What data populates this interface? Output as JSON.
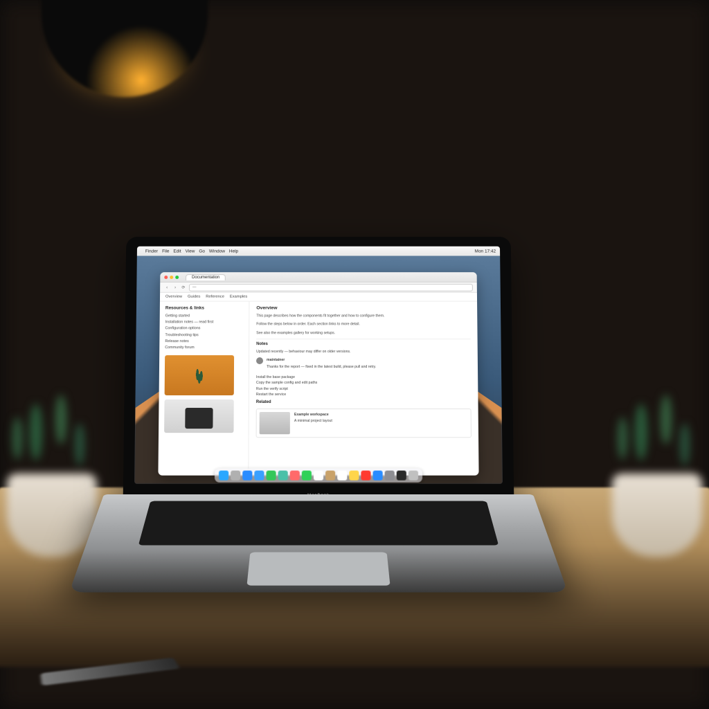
{
  "menubar": {
    "apple": "",
    "items": [
      "Finder",
      "File",
      "Edit",
      "View",
      "Go",
      "Window",
      "Help"
    ],
    "right": [
      "Mon 17:42"
    ]
  },
  "browser": {
    "tab_title": "Documentation",
    "url": "—",
    "nav": {
      "back": "‹",
      "forward": "›",
      "reload": "⟳"
    },
    "toolbar": [
      "Overview",
      "Guides",
      "Reference",
      "Examples"
    ]
  },
  "sidebar": {
    "heading": "Resources & links",
    "items": [
      "Getting started",
      "Installation notes — read first",
      "Configuration options",
      "Troubleshooting tips",
      "Release notes",
      "Community forum"
    ]
  },
  "article": {
    "heading": "Overview",
    "lines": [
      "This page describes how the components fit together and how to configure them.",
      "Follow the steps below in order. Each section links to more detail.",
      "See also the examples gallery for working setups."
    ],
    "section2": "Notes",
    "note_line": "Updated recently — behaviour may differ on older versions.",
    "comment": {
      "author": "maintainer",
      "text": "Thanks for the report — fixed in the latest build, please pull and retry."
    },
    "bullets": [
      "Install the base package",
      "Copy the sample config and edit paths",
      "Run the verify script",
      "Restart the service"
    ],
    "section3": "Related",
    "card": {
      "title": "Example workspace",
      "subtitle": "A minimal project layout"
    }
  },
  "dock": {
    "items": [
      {
        "name": "finder",
        "color": "#2aa7ff"
      },
      {
        "name": "launchpad",
        "color": "#b0b0b0"
      },
      {
        "name": "safari",
        "color": "#2a8cff"
      },
      {
        "name": "mail",
        "color": "#3aa0ff"
      },
      {
        "name": "messages",
        "color": "#34c759"
      },
      {
        "name": "maps",
        "color": "#4ac0a8"
      },
      {
        "name": "photos",
        "color": "#ff6a6a"
      },
      {
        "name": "facetime",
        "color": "#30d158"
      },
      {
        "name": "calendar",
        "color": "#ffffff"
      },
      {
        "name": "contacts",
        "color": "#c9a26a"
      },
      {
        "name": "reminders",
        "color": "#ffffff"
      },
      {
        "name": "notes",
        "color": "#ffd54a"
      },
      {
        "name": "music",
        "color": "#ff3b30"
      },
      {
        "name": "appstore",
        "color": "#2a8cff"
      },
      {
        "name": "settings",
        "color": "#8e8e93"
      },
      {
        "name": "terminal",
        "color": "#2a2a2a"
      },
      {
        "name": "trash",
        "color": "#c0c0c0"
      }
    ]
  },
  "laptop": {
    "brand": "MacBook"
  }
}
